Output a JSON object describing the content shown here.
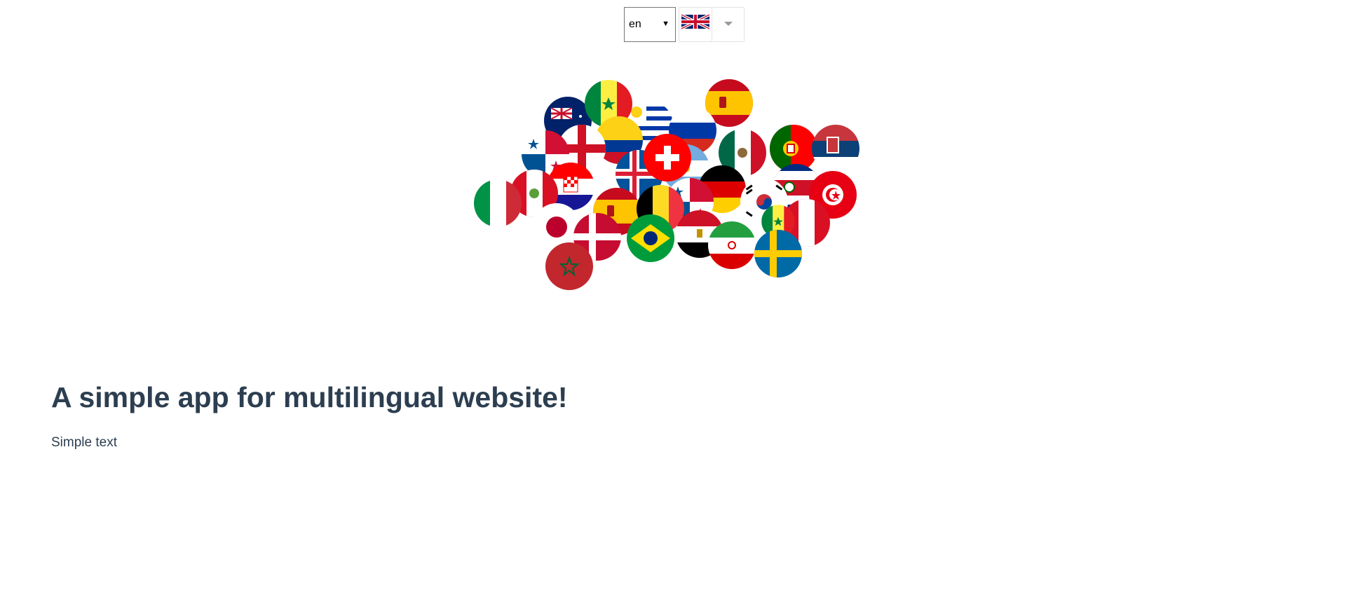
{
  "language_select": {
    "value": "en",
    "arrow": "▼"
  },
  "flag_dropdown": {
    "selected_flag": "uk-flag-icon",
    "caret": "caret-down-icon"
  },
  "page": {
    "title": "A simple app for multilingual website!",
    "text": "Simple text"
  },
  "colors": {
    "text": "#2c3e50",
    "red": "#e30a17",
    "blue": "#012169",
    "yellow": "#fcd116",
    "green": "#00853f"
  }
}
